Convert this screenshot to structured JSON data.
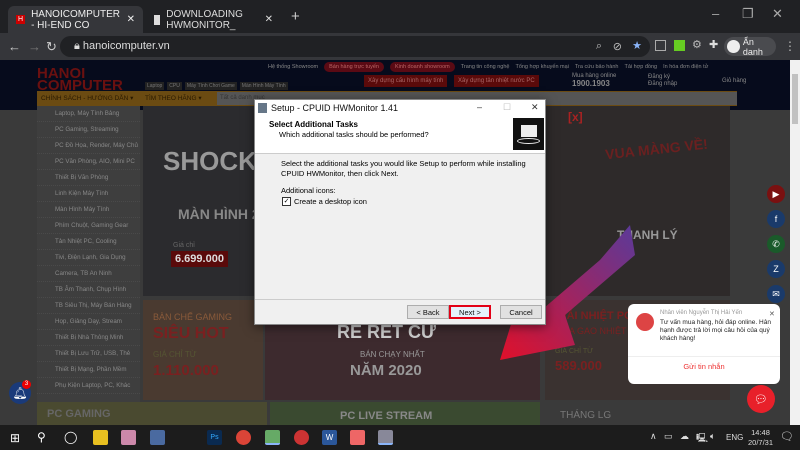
{
  "browser": {
    "tabs": [
      {
        "label": "HANOICOMPUTER - HI-END CO",
        "active": true
      },
      {
        "label": "DOWNLOADING HWMONITOR_",
        "active": false
      }
    ],
    "new_tab": "+",
    "url": "hanoicomputer.vn",
    "profile": "Ẩn danh"
  },
  "site": {
    "logo": "HANOI COMPUTER",
    "top_links": [
      "Hệ thống Showroom",
      "Bán hàng trực tuyến",
      "Kinh doanh showroom",
      "Trang tin công nghệ",
      "Tổng hợp khuyến mại",
      "Tra cứu bảo hành",
      "Tải hợp đồng",
      "In hóa đơn điện tử"
    ],
    "quick_tags": [
      "Laptop",
      "CPU",
      "Máy Tính Chơi Game",
      "Màn Hình Máy Tính"
    ],
    "build_pc": "Xây dựng cấu hình máy tính",
    "build_cooling": "Xây dựng tản nhiệt nước PC",
    "hotline_label": "Mua hàng online",
    "hotline": "1900.1903",
    "login": "Đăng ký",
    "login2": "Đăng nhập",
    "cart": "Giỏ hàng",
    "nav": [
      "CHÍNH SÁCH - HƯỚNG DẪN ▾",
      "TÌM THEO HÃNG ▾"
    ],
    "search_category": "Tất cả danh mục",
    "categories": [
      "Laptop, Máy Tính Bảng",
      "PC Gaming, Streaming",
      "PC Đồ Họa, Render, Máy Chủ",
      "PC Văn Phòng, AIO, Mini PC",
      "Thiết Bị Văn Phòng",
      "Linh Kiện Máy Tính",
      "Màn Hình Máy Tính",
      "Phím Chuột, Gaming Gear",
      "Tản Nhiệt PC, Cooling",
      "Tivi, Điện Lạnh, Gia Dụng",
      "Camera, TB An Ninh",
      "TB Âm Thanh, Chụp Hình",
      "TB Siêu Thị, Máy Bán Hàng",
      "Họp, Giảng Dạy, Stream",
      "Thiết Bị Nhà Thông Minh",
      "Thiết Bị Lưu Trữ, USB, Thẻ",
      "Thiết Bị Mạng, Phần Mềm",
      "Phụ Kiện Laptop, PC, Khác"
    ],
    "banners": {
      "shock": "SHOCK",
      "monitor": "MÀN HÌNH 27\" 1",
      "price_label": "Giá chỉ",
      "price": "6.699.000",
      "gaming": "BÀN CHẾ GAMING",
      "sieu_hot": "SIÊU HOT",
      "gia_chi": "GIÁ CHỈ TỪ",
      "price2": "1.110.000",
      "re_ret": "RẺ RẾT CỬ",
      "ban_chay": "BÁN CHẠY NHẤT",
      "nam": "NĂM 2020",
      "vua": "VUA MÀNG VỀ!",
      "thanh_ly": "THANH LÝ",
      "giai_nhiet": "GIẢI NHIỆT PC",
      "mua_gao": "MUA GAO NHIỆT",
      "gia_chi3": "GIÁ CHỈ TỪ",
      "price3": "589.000",
      "pc_gaming": "PC GAMING",
      "pc_live": "PC LIVE STREAM",
      "thang_lg": "THÁNG LG",
      "close_x": "[x]"
    },
    "notification_count": "3"
  },
  "dialog": {
    "title": "Setup - CPUID HWMonitor 1.41",
    "heading": "Select Additional Tasks",
    "subheading": "Which additional tasks should be performed?",
    "body": "Select the additional tasks you would like Setup to perform while installing CPUID HWMonitor, then click Next.",
    "group_label": "Additional icons:",
    "checkbox_label": "Create a desktop icon",
    "checkbox_checked": true,
    "back": "< Back",
    "next": "Next >",
    "cancel": "Cancel",
    "highlight_color": "#e30016"
  },
  "chat": {
    "agent": "Nhân viên Nguyễn Thị Hải Yến",
    "message": "Tư vấn mua hàng, hỏi đáp online. Hân hạnh được trả lời mọi câu hỏi của quý khách hàng!",
    "action": "Gửi tin nhắn"
  },
  "taskbar": {
    "lang": "ENG",
    "time": "14:48",
    "date": "20/7/31",
    "notif": "1"
  }
}
